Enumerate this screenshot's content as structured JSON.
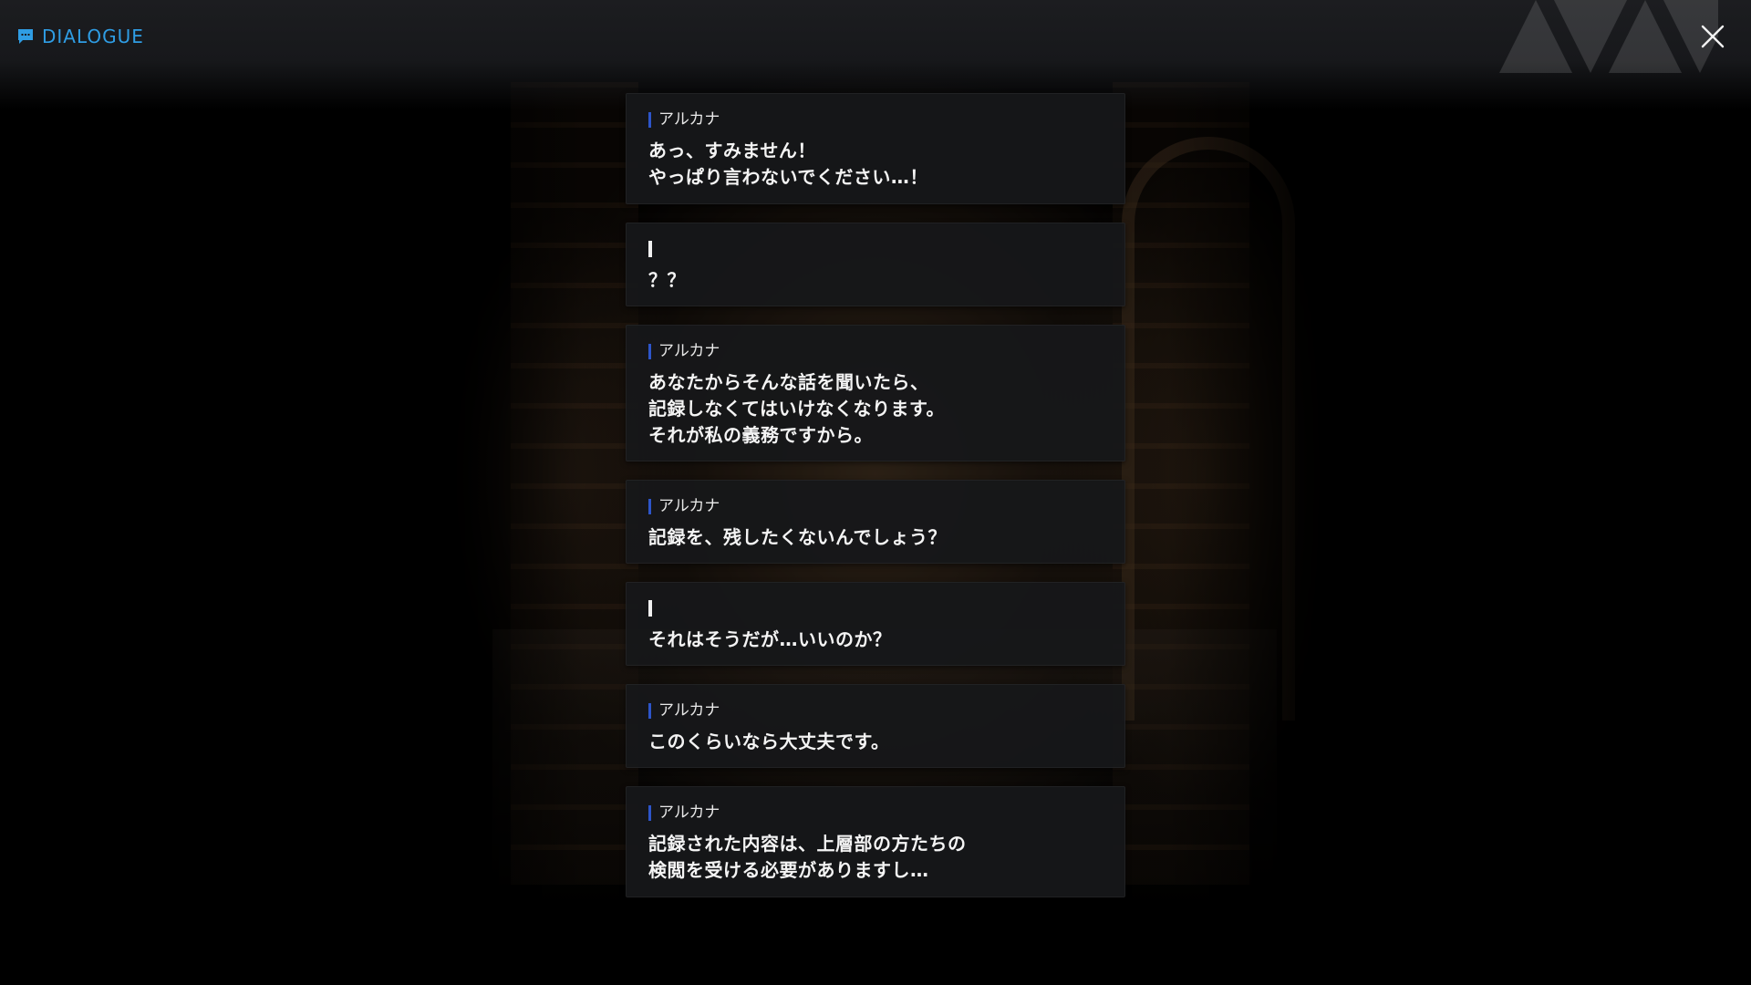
{
  "header": {
    "title": "DIALOGUE",
    "title_icon": "chat-bubble-icon",
    "close_icon": "close-icon",
    "accent_color": "#2f9de4"
  },
  "dialogue": [
    {
      "speaker": "アルカナ",
      "text": "あっ、すみません！\nやっぱり言わないでください…！"
    },
    {
      "speaker": "",
      "text": "？？"
    },
    {
      "speaker": "アルカナ",
      "text": "あなたからそんな話を聞いたら、\n記録しなくてはいけなくなります。\nそれが私の義務ですから。"
    },
    {
      "speaker": "アルカナ",
      "text": "記録を、残したくないんでしょう？"
    },
    {
      "speaker": "",
      "text": "それはそうだが…いいのか？"
    },
    {
      "speaker": "アルカナ",
      "text": "このくらいなら大丈夫です。"
    },
    {
      "speaker": "アルカナ",
      "text": "記録された内容は、上層部の方たちの\n検閲を受ける必要がありますし…"
    }
  ],
  "speaker_bar_color": "#2d55c9"
}
